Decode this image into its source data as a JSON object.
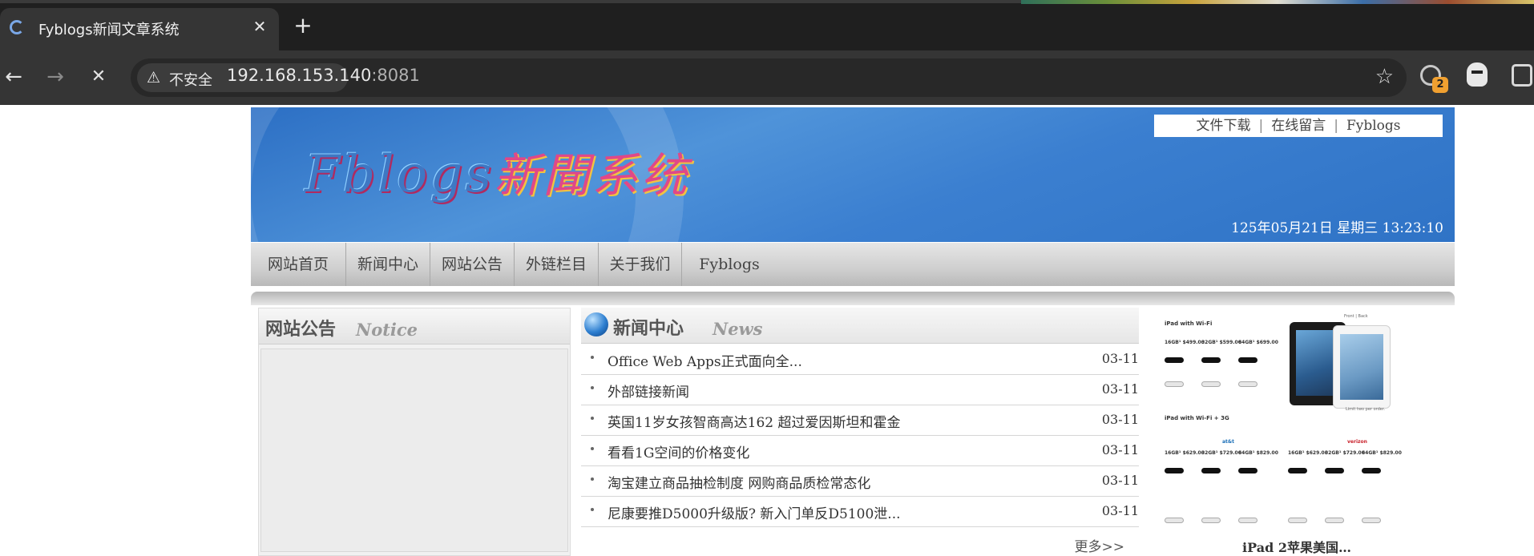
{
  "browser": {
    "tab_title": "Fyblogs新闻文章系统",
    "tab_close_glyph": "✕",
    "new_tab_glyph": "+",
    "back_glyph": "←",
    "forward_glyph": "→",
    "stop_glyph": "✕",
    "security_icon": "⚠",
    "security_label": "不安全",
    "url_host": "192.168.153.140",
    "url_port": ":8081",
    "star_glyph": "☆",
    "extension_badge": "2",
    "icons": [
      "loading-spinner-icon",
      "close-icon",
      "plus-icon",
      "back-arrow-icon",
      "forward-arrow-icon",
      "stop-icon",
      "warning-icon",
      "star-icon",
      "extension-icon",
      "mask-icon",
      "puzzle-icon"
    ]
  },
  "site": {
    "logo_latin": "Fblogs",
    "logo_cn": "新聞系统",
    "top_links": [
      "文件下载",
      "在线留言",
      "Fyblogs"
    ],
    "top_link_separator": "|",
    "clock": "125年05月21日  星期三  13:23:10",
    "nav": [
      "网站首页",
      "新闻中心",
      "网站公告",
      "外链栏目",
      "关于我们",
      "Fyblogs"
    ],
    "notice": {
      "title_cn": "网站公告",
      "title_en": "Notice"
    },
    "news": {
      "title_cn": "新闻中心",
      "title_en": "News",
      "bullet": "•",
      "items": [
        {
          "title": "Office  Web  Apps正式面向全...",
          "date": "03-11"
        },
        {
          "title": "外部链接新闻",
          "date": "03-11"
        },
        {
          "title": "英国11岁女孩智商高达162  超过爱因斯坦和霍金",
          "date": "03-11"
        },
        {
          "title": "看看1G空间的价格变化",
          "date": "03-11"
        },
        {
          "title": "淘宝建立商品抽检制度  网购商品质检常态化",
          "date": "03-11"
        },
        {
          "title": "尼康要推D5000升级版?  新入门单反D5100泄...",
          "date": "03-11"
        }
      ],
      "more": "更多>>"
    },
    "ad": {
      "caption": "iPad  2苹果美国…",
      "image_text": {
        "wifi_header": "iPad with Wi-Fi",
        "wifi3g_header": "iPad with Wi-Fi + 3G",
        "prices_wifi": [
          "16GB¹ $499.00",
          "32GB¹ $599.00",
          "64GB¹ $699.00"
        ],
        "prices_3g": [
          "16GB¹ $629.00",
          "32GB¹ $729.00",
          "64GB¹ $829.00",
          "16GB¹ $629.00",
          "32GB¹ $729.00",
          "64GB¹ $829.00"
        ],
        "carrier_left": "at&t",
        "carrier_right": "verizon",
        "front_back": "Front | Back",
        "limit_note": "Limit two per order."
      }
    }
  }
}
